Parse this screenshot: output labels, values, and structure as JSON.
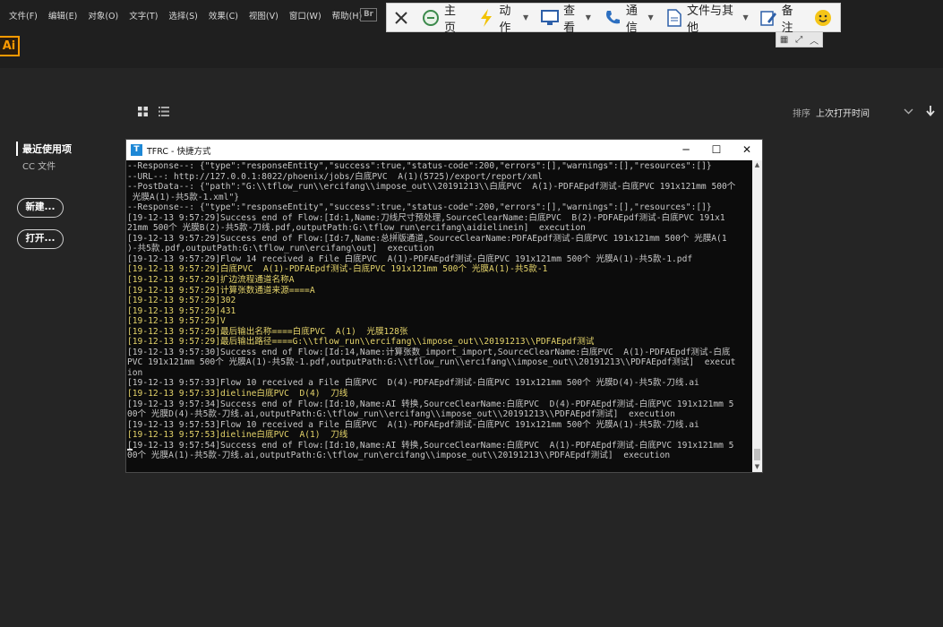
{
  "menubar": {
    "items": [
      "文件(F)",
      "编辑(E)",
      "对象(O)",
      "文字(T)",
      "选择(S)",
      "效果(C)",
      "视图(V)",
      "窗口(W)",
      "帮助(H)"
    ],
    "bridge_badge": "Br"
  },
  "toolbar": {
    "home": "主页",
    "action": "动作",
    "view": "查看",
    "comm": "通信",
    "files": "文件与其他",
    "notes": "备注"
  },
  "app": {
    "logo": "Ai"
  },
  "home": {
    "sort_label": "排序",
    "sort_value": "上次打开时间",
    "recent": "最近使用项",
    "cc_files": "CC 文件",
    "new_button": "新建...",
    "open_button": "打开..."
  },
  "console": {
    "title": "TFRC - 快捷方式",
    "app_icon": "T",
    "lines": [
      {
        "text": "--Response--: {\"type\":\"responseEntity\",\"success\":true,\"status-code\":200,\"errors\":[],\"warnings\":[],\"resources\":[]}",
        "hl": false
      },
      {
        "text": "--URL--: http://127.0.0.1:8022/phoenix/jobs/白底PVC  A(1)(5725)/export/report/xml",
        "hl": false
      },
      {
        "text": "--PostData--: {\"path\":\"G:\\\\tflow_run\\\\ercifang\\\\impose_out\\\\20191213\\\\白底PVC  A(1)-PDFAEpdf测试-白底PVC 191x121mm 500个",
        "hl": false
      },
      {
        "text": " 光膜A(1)-共5款-1.xml\"}",
        "hl": false
      },
      {
        "text": "--Response--: {\"type\":\"responseEntity\",\"success\":true,\"status-code\":200,\"errors\":[],\"warnings\":[],\"resources\":[]}",
        "hl": false
      },
      {
        "text": "[19-12-13 9:57:29]Success end of Flow:[Id:1,Name:刀线尺寸预处理,SourceClearName:白底PVC  B(2)-PDFAEpdf测试-白底PVC 191x1",
        "hl": false
      },
      {
        "text": "21mm 500个 光膜B(2)-共5款-刀线.pdf,outputPath:G:\\tflow_run\\ercifang\\aidielinein]  execution",
        "hl": false
      },
      {
        "text": "[19-12-13 9:57:29]Success end of Flow:[Id:7,Name:总拼版通道,SourceClearName:PDFAEpdf测试-白底PVC 191x121mm 500个 光膜A(1",
        "hl": false
      },
      {
        "text": ")-共5款.pdf,outputPath:G:\\tflow_run\\ercifang\\out]  execution",
        "hl": false
      },
      {
        "text": "[19-12-13 9:57:29]Flow 14 received a File 白底PVC  A(1)-PDFAEpdf测试-白底PVC 191x121mm 500个 光膜A(1)-共5款-1.pdf",
        "hl": false
      },
      {
        "text": "[19-12-13 9:57:29]白底PVC  A(1)-PDFAEpdf测试-白底PVC 191x121mm 500个 光膜A(1)-共5款-1",
        "hl": true
      },
      {
        "text": "[19-12-13 9:57:29]扩边流程通道名称A",
        "hl": true
      },
      {
        "text": "[19-12-13 9:57:29]计算张数通道来源====A",
        "hl": true
      },
      {
        "text": "[19-12-13 9:57:29]302",
        "hl": true
      },
      {
        "text": "[19-12-13 9:57:29]431",
        "hl": true
      },
      {
        "text": "[19-12-13 9:57:29]V",
        "hl": true
      },
      {
        "text": "[19-12-13 9:57:29]最后输出名称====白底PVC  A(1)  光膜128张",
        "hl": true
      },
      {
        "text": "[19-12-13 9:57:29]最后输出路径====G:\\\\tflow_run\\\\ercifang\\\\impose_out\\\\20191213\\\\PDFAEpdf测试",
        "hl": true
      },
      {
        "text": "[19-12-13 9:57:30]Success end of Flow:[Id:14,Name:计算张数_import_import,SourceClearName:白底PVC  A(1)-PDFAEpdf测试-白底",
        "hl": false
      },
      {
        "text": "PVC 191x121mm 500个 光膜A(1)-共5款-1.pdf,outputPath:G:\\\\tflow_run\\\\ercifang\\\\impose_out\\\\20191213\\\\PDFAEpdf测试]  execut",
        "hl": false
      },
      {
        "text": "ion",
        "hl": false
      },
      {
        "text": "[19-12-13 9:57:33]Flow 10 received a File 白底PVC  D(4)-PDFAEpdf测试-白底PVC 191x121mm 500个 光膜D(4)-共5款-刀线.ai",
        "hl": false
      },
      {
        "text": "[19-12-13 9:57:33]dieline白底PVC  D(4)  刀线",
        "hl": true
      },
      {
        "text": "[19-12-13 9:57:34]Success end of Flow:[Id:10,Name:AI 转换,SourceClearName:白底PVC  D(4)-PDFAEpdf测试-白底PVC 191x121mm 5",
        "hl": false
      },
      {
        "text": "00个 光膜D(4)-共5款-刀线.ai,outputPath:G:\\tflow_run\\\\ercifang\\\\impose_out\\\\20191213\\\\PDFAEpdf测试]  execution",
        "hl": false
      },
      {
        "text": "[19-12-13 9:57:53]Flow 10 received a File 白底PVC  A(1)-PDFAEpdf测试-白底PVC 191x121mm 500个 光膜A(1)-共5款-刀线.ai",
        "hl": false
      },
      {
        "text": "[19-12-13 9:57:53]dieline白底PVC  A(1)  刀线",
        "hl": true
      },
      {
        "text": "[19-12-13 9:57:54]Success end of Flow:[Id:10,Name:AI 转换,SourceClearName:白底PVC  A(1)-PDFAEpdf测试-白底PVC 191x121mm 5",
        "hl": false
      },
      {
        "text": "00个 光膜A(1)-共5款-刀线.ai,outputPath:G:\\tflow_run\\ercifang\\\\impose_out\\\\20191213\\\\PDFAEpdf测试]  execution",
        "hl": false
      }
    ]
  },
  "colors": {
    "accent": "#ff9a00",
    "console_bg": "#0c0c0c",
    "console_text": "#c8c8c8",
    "console_highlight": "#e6d56b"
  }
}
